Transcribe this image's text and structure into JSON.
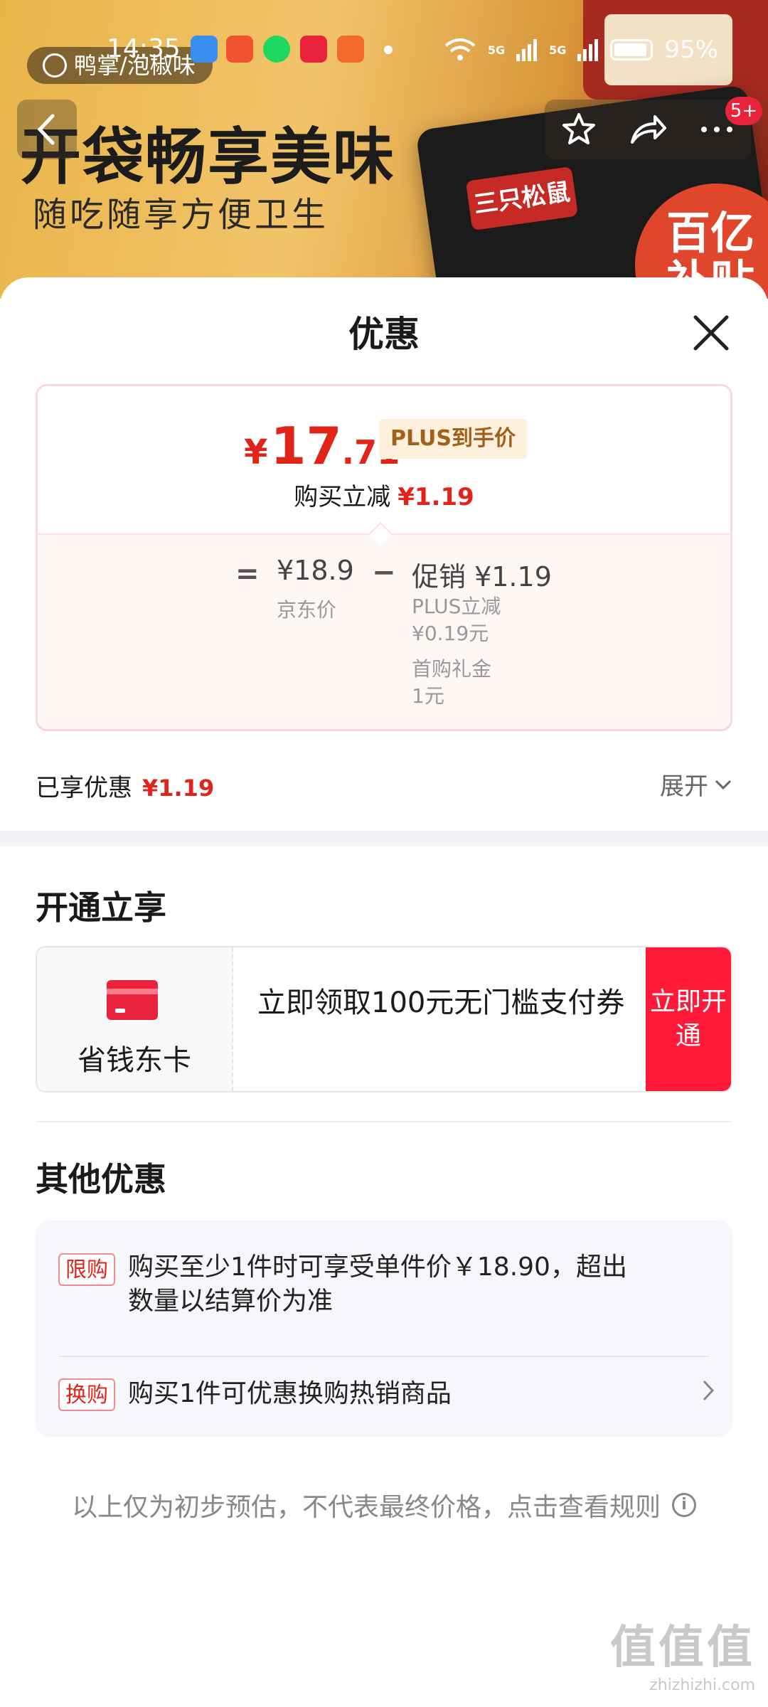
{
  "status_bar": {
    "time": "14:35",
    "battery": "95%",
    "signal_labels": [
      "5G",
      "5G"
    ]
  },
  "banner": {
    "brand_tag": "鸭掌/泡椒味",
    "title": "开袋畅享美味",
    "subtitle": "随吃随享方便卫生",
    "bag_logo": "三只松鼠",
    "subsidy_badge": [
      "百亿",
      "补贴"
    ],
    "notification_count": "5+"
  },
  "sheet": {
    "title": "优惠",
    "price_card": {
      "currency": "¥",
      "price_int": "17",
      "price_dec": ".71",
      "plus_tag": "PLUS到手价",
      "reduce_label": "购买立减",
      "reduce_amount": "¥1.19",
      "equals": "=",
      "jd_price": "¥18.9",
      "jd_price_label": "京东价",
      "minus": "−",
      "promo": "促销 ¥1.19",
      "promo_details": [
        "PLUS立减",
        "¥0.19元",
        "首购礼金",
        "1元"
      ]
    },
    "enjoyed": {
      "label": "已享优惠",
      "amount": "¥1.19",
      "expand": "展开"
    },
    "open_section": {
      "title": "开通立享",
      "card_name": "省钱东卡",
      "text": "立即领取100元无门槛支付券",
      "button": "立即开通"
    },
    "other_section": {
      "title": "其他优惠",
      "items": [
        {
          "tag": "限购",
          "text": "购买至少1件时可享受单件价￥18.90，超出数量以结算价为准"
        },
        {
          "tag": "换购",
          "text": "购买1件可优惠换购热销商品"
        }
      ]
    },
    "disclaimer": "以上仅为初步预估，不代表最终价格，点击查看规则"
  },
  "watermark": {
    "logo": "值值值",
    "url": "zhizhizhi.com"
  }
}
